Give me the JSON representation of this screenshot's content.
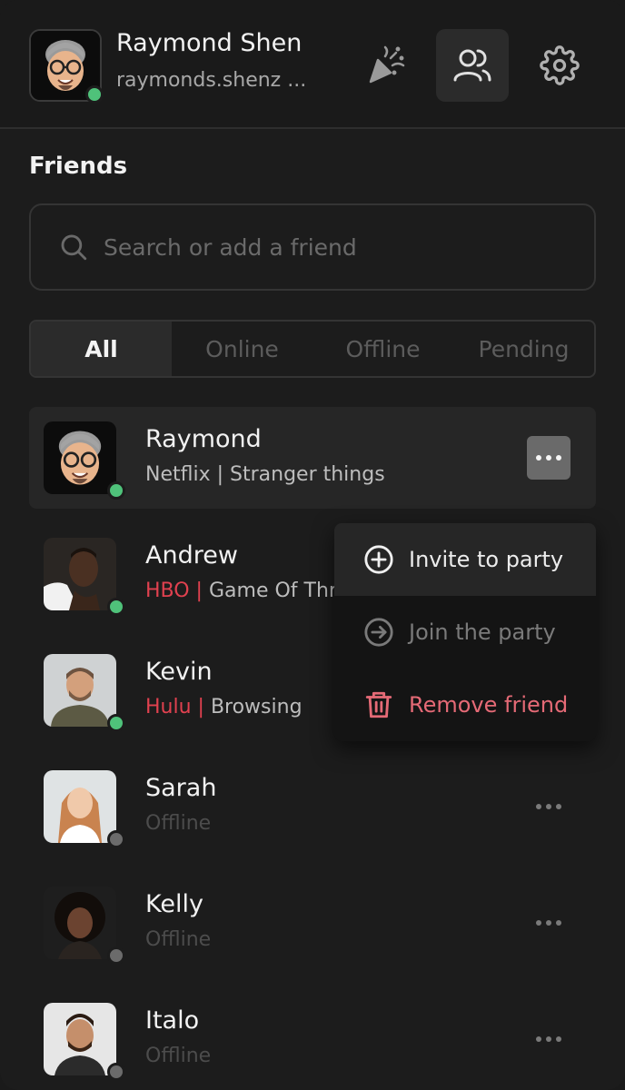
{
  "user": {
    "name": "Raymond Shen",
    "handle": "raymonds.shenz ...",
    "status": "online"
  },
  "header_buttons": [
    {
      "icon": "party-popper-icon"
    },
    {
      "icon": "users-icon",
      "active": true
    },
    {
      "icon": "gear-icon"
    }
  ],
  "friends": {
    "title": "Friends",
    "search_placeholder": "Search or add a friend",
    "tabs": [
      "All",
      "Online",
      "Offline",
      "Pending"
    ],
    "active_tab": "All",
    "list": [
      {
        "name": "Raymond",
        "service": "",
        "activity": "Netflix | Stranger things",
        "status": "online",
        "selected": true
      },
      {
        "name": "Andrew",
        "service": "HBO |",
        "activity": " Game Of Thrones",
        "status": "online"
      },
      {
        "name": "Kevin",
        "service": "Hulu |",
        "activity": " Browsing",
        "status": "online"
      },
      {
        "name": "Sarah",
        "service": "",
        "activity": "Offline",
        "status": "offline"
      },
      {
        "name": "Kelly",
        "service": "",
        "activity": "Offline",
        "status": "offline"
      },
      {
        "name": "Italo",
        "service": "",
        "activity": "Offline",
        "status": "offline"
      }
    ]
  },
  "context_menu": {
    "items": [
      {
        "label": "Invite to party",
        "icon": "plus-circle-icon",
        "state": "hover"
      },
      {
        "label": "Join the party",
        "icon": "arrow-right-circle-icon",
        "state": "disabled"
      },
      {
        "label": "Remove friend",
        "icon": "trash-icon",
        "state": "danger"
      }
    ]
  },
  "colors": {
    "background": "#1c1c1c",
    "online": "#4fc27a",
    "offline": "#6b6b6b",
    "service_red": "#e0414f",
    "danger": "#e56a76"
  }
}
